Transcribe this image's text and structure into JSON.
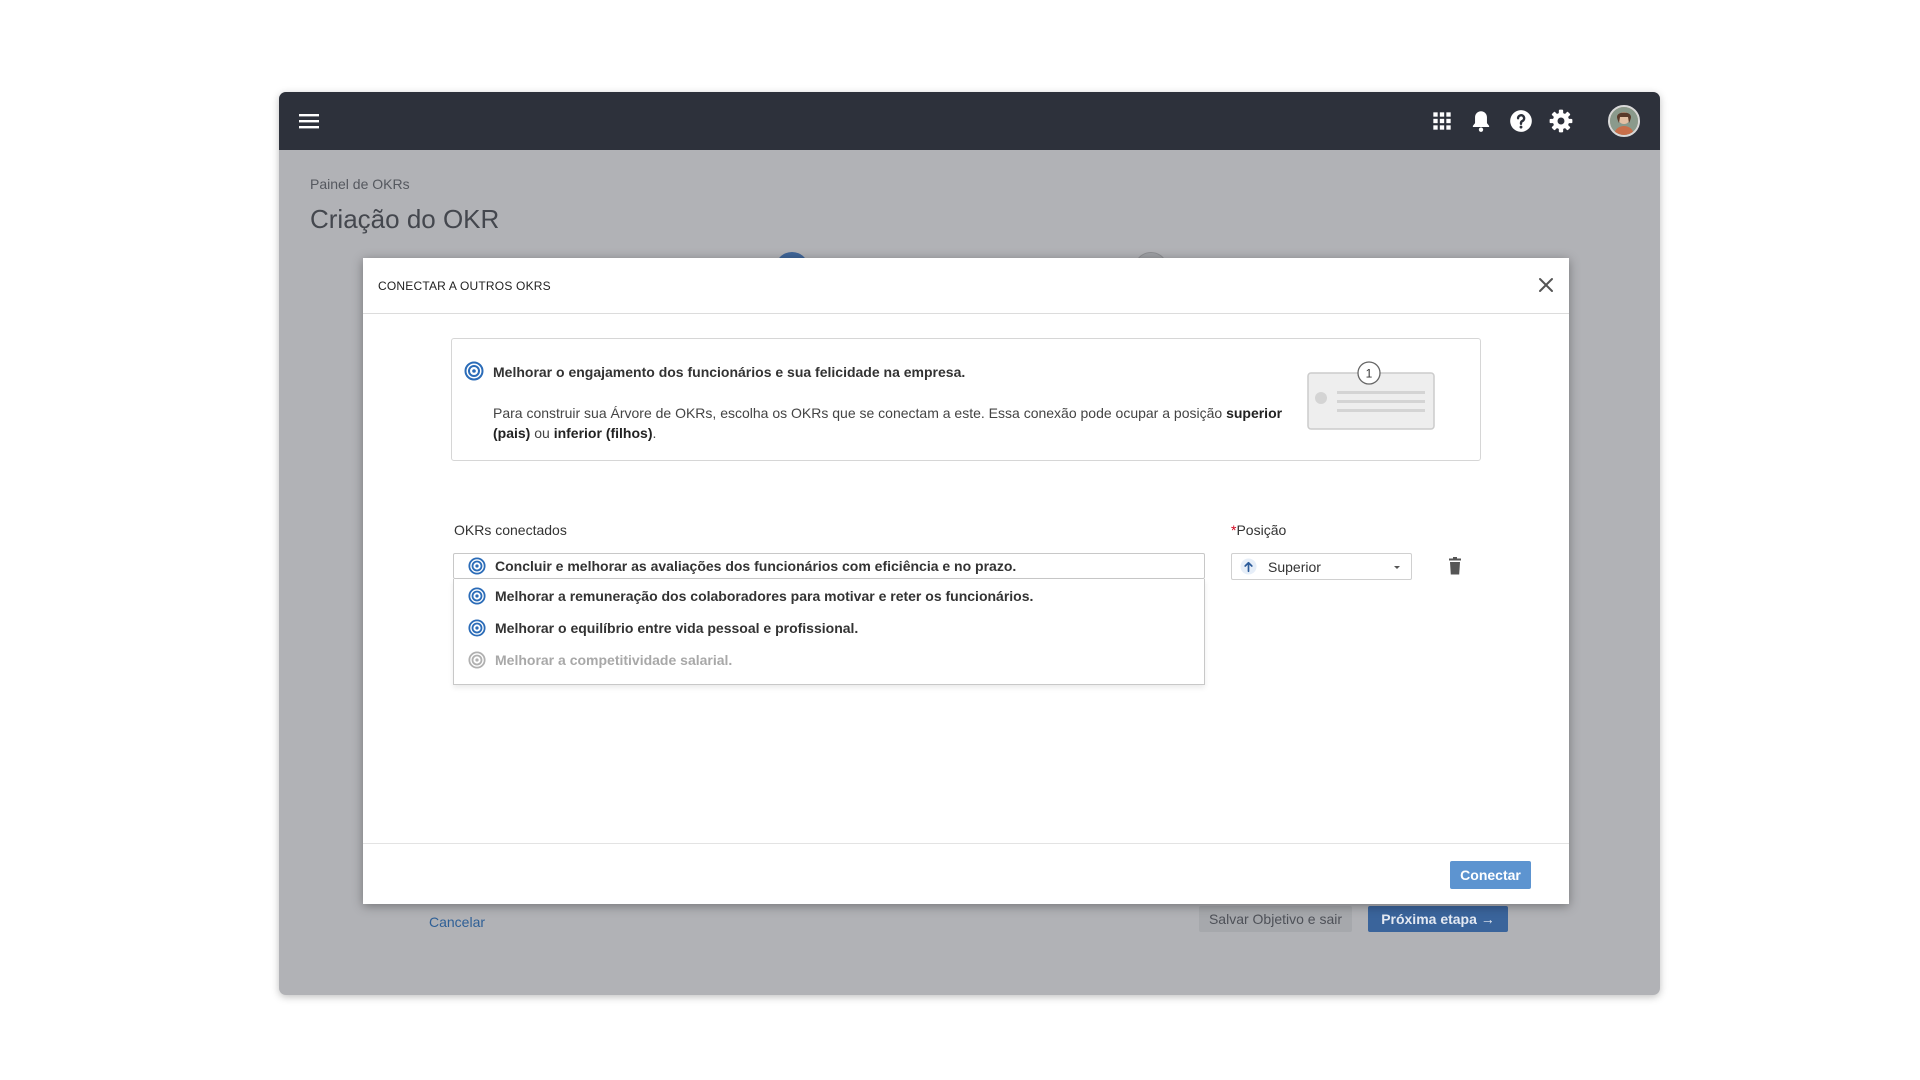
{
  "background_page": {
    "breadcrumb": "Painel de OKRs",
    "title": "Criação do OKR",
    "cancel_label": "Cancelar",
    "save_label": "Salvar Objetivo e sair",
    "next_label": "Próxima etapa"
  },
  "topbar": {
    "icons": [
      "menu-icon",
      "apps-grid-icon",
      "bell-icon",
      "help-icon",
      "gear-icon",
      "avatar"
    ]
  },
  "modal": {
    "title": "CONECTAR A OUTROS OKRS",
    "info": {
      "objective": "Melhorar o engajamento dos funcionários e sua felicidade na empresa.",
      "desc_part1": "Para construir sua Árvore de OKRs, escolha os OKRs que se conectam a este. Essa conexão pode ocupar a posição ",
      "desc_bold1": "superior (pais)",
      "desc_part2": " ou ",
      "desc_bold2": "inferior (filhos)",
      "desc_part3": ".",
      "illustration_badge": "1"
    },
    "connected_label": "OKRs conectados",
    "position_required_mark": "*",
    "position_label": "Posição",
    "selected_okr": "Concluir e melhorar as avaliações dos funcionários com eficiência e no prazo.",
    "options": [
      {
        "label": "Melhorar a remuneração dos colaboradores para motivar e reter os funcionários.",
        "disabled": false
      },
      {
        "label": "Melhorar o equilíbrio entre vida pessoal e profissional.",
        "disabled": false
      },
      {
        "label": "Melhorar a competitividade salarial.",
        "disabled": true
      }
    ],
    "position_value": "Superior",
    "connect_label": "Conectar"
  },
  "colors": {
    "topbar": "#2d313b",
    "accent": "#2b6cb8",
    "connect_button": "#5d94d0",
    "overlay_bg": "#b1b2b6"
  }
}
